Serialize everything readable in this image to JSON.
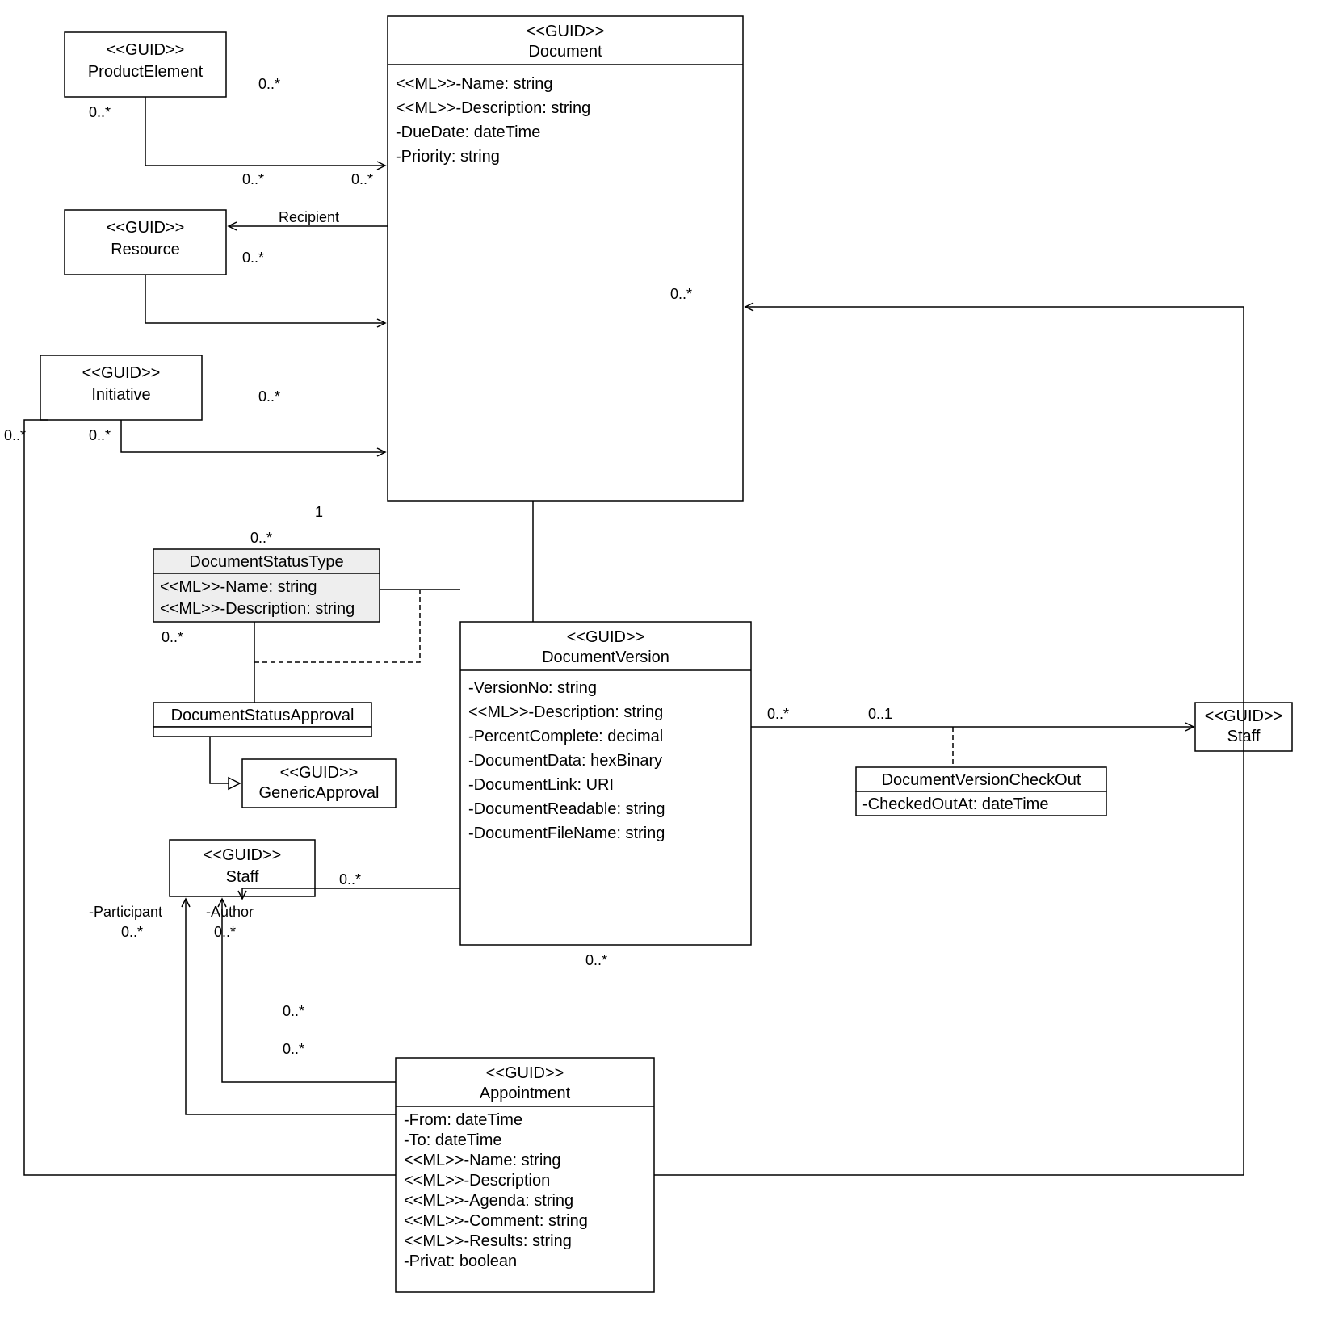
{
  "classes": {
    "productElement": {
      "stereo": "<<GUID>>",
      "name": "ProductElement"
    },
    "resource": {
      "stereo": "<<GUID>>",
      "name": "Resource"
    },
    "initiative": {
      "stereo": "<<GUID>>",
      "name": "Initiative"
    },
    "document": {
      "stereo": "<<GUID>>",
      "name": "Document",
      "attrs": [
        "<<ML>>-Name: string",
        "<<ML>>-Description: string",
        "-DueDate: dateTime",
        "-Priority: string"
      ]
    },
    "documentStatusType": {
      "name": "DocumentStatusType",
      "attrs": [
        "<<ML>>-Name: string",
        "<<ML>>-Description: string"
      ]
    },
    "documentStatusApproval": {
      "name": "DocumentStatusApproval"
    },
    "genericApproval": {
      "stereo": "<<GUID>>",
      "name": "GenericApproval"
    },
    "documentVersion": {
      "stereo": "<<GUID>>",
      "name": "DocumentVersion",
      "attrs": [
        "-VersionNo: string",
        "<<ML>>-Description: string",
        "-PercentComplete: decimal",
        "-DocumentData: hexBinary",
        "-DocumentLink: URI",
        "-DocumentReadable: string",
        "-DocumentFileName: string"
      ]
    },
    "documentVersionCheckOut": {
      "name": "DocumentVersionCheckOut",
      "attrs": [
        "-CheckedOutAt: dateTime"
      ]
    },
    "staff1": {
      "stereo": "<<GUID>>",
      "name": "Staff"
    },
    "staff2": {
      "stereo": "<<GUID>>",
      "name": "Staff"
    },
    "appointment": {
      "stereo": "<<GUID>>",
      "name": "Appointment",
      "attrs": [
        "-From: dateTime",
        "-To: dateTime",
        "<<ML>>-Name: string",
        "<<ML>>-Description",
        "<<ML>>-Agenda: string",
        "<<ML>>-Comment: string",
        "<<ML>>-Results: string",
        "-Privat: boolean"
      ]
    }
  },
  "labels": {
    "m01": "0..*",
    "m02": "0..*",
    "m03": "0..*",
    "m04": "0..*",
    "m05": "0..*",
    "m06": "0..*",
    "m07": "0..*",
    "m08": "0..*",
    "m09": "1",
    "m10": "0..*",
    "m11": "0..*",
    "m12": "0..1",
    "m13": "0..*",
    "m14": "0..*",
    "m15": "0..*",
    "m16": "0..*",
    "m17": "0..*",
    "m18": "0..*",
    "recipient": "Recipient",
    "participant": "-Participant",
    "author": "-Author"
  }
}
